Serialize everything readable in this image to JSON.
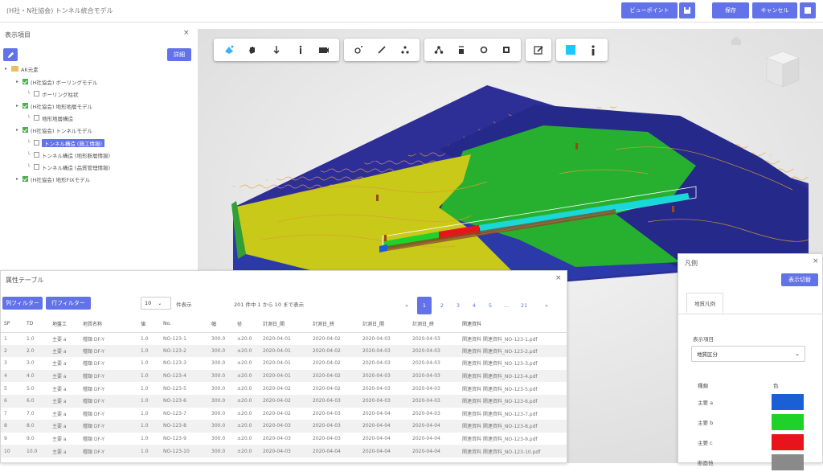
{
  "header": {
    "app_title": "(H社・N社協会) トンネル統合モデル",
    "viewpoint_label": "ビューポイント",
    "save_label": "保存",
    "cancel_label": "キャンセル"
  },
  "tree_panel": {
    "title": "表示項目",
    "display_button": "詳細",
    "items": [
      {
        "label": "AK元素",
        "level": 0,
        "checked": false
      },
      {
        "label": "(H社協会) ボーリングモデル",
        "level": 1,
        "checked": true
      },
      {
        "label": "ボーリング柱状",
        "level": 2,
        "checked": false
      },
      {
        "label": "(H社協会) 地形地層モデル",
        "level": 1,
        "checked": true
      },
      {
        "label": "地形地層構造",
        "level": 2,
        "checked": false
      },
      {
        "label": "(H社協会) トンネルモデル",
        "level": 1,
        "checked": true
      },
      {
        "label": "トンネル構造 (施工情報)",
        "level": 2,
        "checked": false,
        "selected": true
      },
      {
        "label": "トンネル構造 (地形断層情報)",
        "level": 2,
        "checked": false
      },
      {
        "label": "トンネル構造 (品質管理情報)",
        "level": 2,
        "checked": false
      },
      {
        "label": "(H社協会) 地形FIXモデル",
        "level": 1,
        "checked": true
      }
    ]
  },
  "toolbar": {
    "groups": [
      [
        "rotate-icon",
        "pan-icon",
        "move-down-icon",
        "walk-icon",
        "camera-icon"
      ],
      [
        "measure-point-icon",
        "measure-line-icon",
        "measure-area-icon"
      ],
      [
        "section-icon",
        "clip-icon",
        "focus-icon",
        "fit-icon"
      ],
      [
        "annotate-icon"
      ],
      [
        "color-icon",
        "info-icon"
      ]
    ]
  },
  "table_panel": {
    "title": "属性テーブル",
    "filter1": "列フィルター",
    "filter2": "行フィルター",
    "page_size": "10",
    "page_size_unit": "件表示",
    "range_text": "201 件中 1 から 10 まで表示",
    "pages": [
      "1",
      "2",
      "3",
      "4",
      "5",
      "...",
      "21",
      "»"
    ],
    "current_page": "1",
    "columns": [
      "SP",
      "TD",
      "地盤工",
      "地質名称",
      "値",
      "No.",
      "TD",
      "幅",
      "径",
      "計測日_開",
      "計測日_終",
      "計測日_開",
      "計測日_終",
      "関連資料"
    ],
    "rows": [
      [
        "1",
        "1.0",
        "主要 a",
        "種類 DF-Y",
        "1.0",
        "NO-123-1",
        "300.0",
        "±20.0",
        "2020-04-01",
        "2020-04-02",
        "2020-04-03",
        "2020-04-03",
        "関連資料 関連資料_NO-123-1.pdf"
      ],
      [
        "2",
        "2.0",
        "主要 a",
        "種類 DF-Y",
        "1.0",
        "NO-123-2",
        "300.0",
        "±20.0",
        "2020-04-01",
        "2020-04-02",
        "2020-04-03",
        "2020-04-03",
        "関連資料 関連資料_NO-123-2.pdf"
      ],
      [
        "3",
        "3.0",
        "主要 a",
        "種類 DF-Y",
        "1.0",
        "NO-123-3",
        "300.0",
        "±20.0",
        "2020-04-01",
        "2020-04-02",
        "2020-04-03",
        "2020-04-03",
        "関連資料 関連資料_NO-123-3.pdf"
      ],
      [
        "4",
        "4.0",
        "主要 a",
        "種類 DF-Y",
        "1.0",
        "NO-123-4",
        "300.0",
        "±20.0",
        "2020-04-01",
        "2020-04-02",
        "2020-04-03",
        "2020-04-03",
        "関連資料 関連資料_NO-123-4.pdf"
      ],
      [
        "5",
        "5.0",
        "主要 a",
        "種類 DF-Y",
        "1.0",
        "NO-123-5",
        "300.0",
        "±20.0",
        "2020-04-02",
        "2020-04-02",
        "2020-04-03",
        "2020-04-03",
        "関連資料 関連資料_NO-123-5.pdf"
      ],
      [
        "6",
        "6.0",
        "主要 a",
        "種類 DF-Y",
        "1.0",
        "NO-123-6",
        "300.0",
        "±20.0",
        "2020-04-02",
        "2020-04-03",
        "2020-04-03",
        "2020-04-03",
        "関連資料 関連資料_NO-123-6.pdf"
      ],
      [
        "7",
        "7.0",
        "主要 a",
        "種類 DF-Y",
        "1.0",
        "NO-123-7",
        "300.0",
        "±20.0",
        "2020-04-02",
        "2020-04-03",
        "2020-04-04",
        "2020-04-03",
        "関連資料 関連資料_NO-123-7.pdf"
      ],
      [
        "8",
        "8.0",
        "主要 a",
        "種類 DF-Y",
        "1.0",
        "NO-123-8",
        "300.0",
        "±20.0",
        "2020-04-03",
        "2020-04-03",
        "2020-04-04",
        "2020-04-04",
        "関連資料 関連資料_NO-123-8.pdf"
      ],
      [
        "9",
        "9.0",
        "主要 a",
        "種類 DF-Y",
        "1.0",
        "NO-123-9",
        "300.0",
        "±20.0",
        "2020-04-03",
        "2020-04-03",
        "2020-04-04",
        "2020-04-04",
        "関連資料 関連資料_NO-123-9.pdf"
      ],
      [
        "10",
        "10.0",
        "主要 a",
        "種類 DF-Y",
        "1.0",
        "NO-123-10",
        "300.0",
        "±20.0",
        "2020-04-03",
        "2020-04-04",
        "2020-04-04",
        "2020-04-04",
        "関連資料 関連資料_NO-123-10.pdf"
      ]
    ]
  },
  "legend_panel": {
    "title": "凡例",
    "button": "表示切替",
    "tab": "地質凡例",
    "select_label": "表示項目",
    "select_value": "地質区分",
    "col_name": "種類",
    "col_color": "色",
    "items": [
      {
        "label": "主要 a",
        "color": "#1a5fd6"
      },
      {
        "label": "主要 b",
        "color": "#1ed22a"
      },
      {
        "label": "主要 c",
        "color": "#e8141c"
      },
      {
        "label": "断面他",
        "color": "#8a8a8a"
      }
    ]
  },
  "colors": {
    "accent": "#6272e8",
    "terrain_yellow": "#c8c81e",
    "terrain_green": "#2bb334",
    "terrain_navy": "#272b8c"
  }
}
